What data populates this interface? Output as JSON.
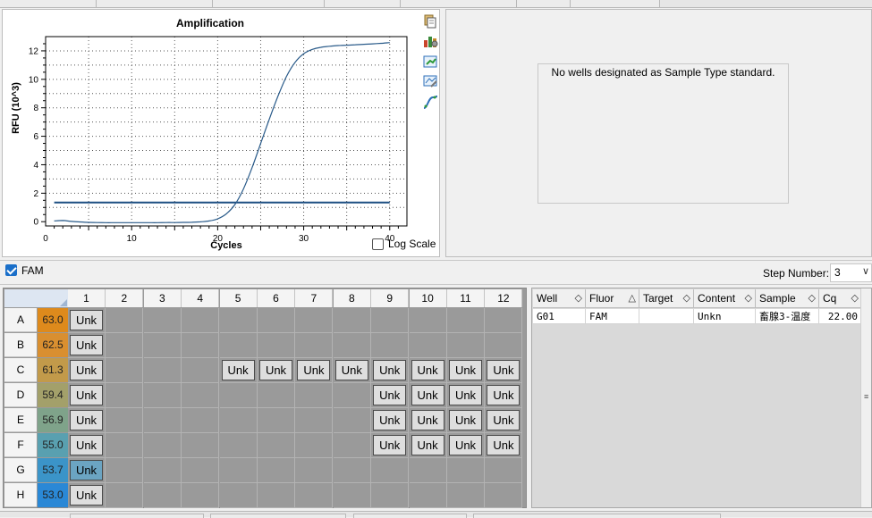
{
  "chart": {
    "logscale_label": "Log Scale",
    "logscale_checked": false
  },
  "chart_data": {
    "type": "line",
    "title": "Amplification",
    "xlabel": "Cycles",
    "ylabel": "RFU (10^3)",
    "xlim": [
      0,
      42
    ],
    "ylim": [
      -0.3,
      13
    ],
    "xticks": [
      0,
      10,
      20,
      30,
      40
    ],
    "yticks": [
      0,
      2,
      4,
      6,
      8,
      10,
      12
    ],
    "grid": true,
    "threshold": 1.35,
    "series": [
      {
        "color": "#2a5b8a",
        "x": [
          1,
          2,
          3,
          4,
          5,
          6,
          7,
          8,
          9,
          10,
          11,
          12,
          13,
          14,
          15,
          16,
          17,
          18,
          19,
          20,
          21,
          22,
          23,
          24,
          25,
          26,
          27,
          28,
          29,
          30,
          31,
          32,
          33,
          34,
          35,
          36,
          37,
          38,
          39,
          40
        ],
        "y": [
          0.05,
          0.08,
          0.02,
          -0.02,
          -0.05,
          -0.06,
          -0.07,
          -0.07,
          -0.07,
          -0.07,
          -0.07,
          -0.07,
          -0.07,
          -0.06,
          -0.06,
          -0.05,
          -0.04,
          -0.01,
          0.05,
          0.2,
          0.55,
          1.2,
          2.3,
          3.8,
          5.5,
          7.2,
          8.8,
          10.2,
          11.2,
          11.8,
          12.1,
          12.25,
          12.32,
          12.37,
          12.4,
          12.43,
          12.46,
          12.49,
          12.53,
          12.58
        ]
      }
    ]
  },
  "std_curve": {
    "message": "No wells designated as Sample Type standard."
  },
  "fluor_bar": {
    "fluor": "FAM",
    "fluor_checked": true,
    "step_label": "Step Number:",
    "step_value": "3"
  },
  "plate": {
    "columns": [
      "1",
      "2",
      "3",
      "4",
      "5",
      "6",
      "7",
      "8",
      "9",
      "10",
      "11",
      "12"
    ],
    "rows": [
      {
        "label": "A",
        "temp": "63.0",
        "color": "#de8a1c",
        "wells": [
          1
        ]
      },
      {
        "label": "B",
        "temp": "62.5",
        "color": "#d98f30",
        "wells": [
          1
        ]
      },
      {
        "label": "C",
        "temp": "61.3",
        "color": "#c29a4a",
        "wells": [
          1,
          5,
          6,
          7,
          8,
          9,
          10,
          11,
          12
        ]
      },
      {
        "label": "D",
        "temp": "59.4",
        "color": "#a3a06a",
        "wells": [
          1,
          9,
          10,
          11,
          12
        ]
      },
      {
        "label": "E",
        "temp": "56.9",
        "color": "#7fa38a",
        "wells": [
          1,
          9,
          10,
          11,
          12
        ]
      },
      {
        "label": "F",
        "temp": "55.0",
        "color": "#59a0b0",
        "wells": [
          1,
          9,
          10,
          11,
          12
        ]
      },
      {
        "label": "G",
        "temp": "53.7",
        "color": "#3b94c8",
        "wells": [
          1
        ],
        "selected": 1
      },
      {
        "label": "H",
        "temp": "53.0",
        "color": "#2a88d6",
        "wells": [
          1
        ]
      }
    ],
    "well_label": "Unk"
  },
  "table": {
    "headers": [
      "Well",
      "Fluor",
      "Target",
      "Content",
      "Sample",
      "Cq"
    ],
    "sort_icons": [
      "◇",
      "△",
      "◇",
      "◇",
      "◇",
      "◇"
    ],
    "rows": [
      [
        "G01",
        "FAM",
        "",
        "Unkn",
        "畜腺3-温度",
        "22.00"
      ]
    ]
  }
}
